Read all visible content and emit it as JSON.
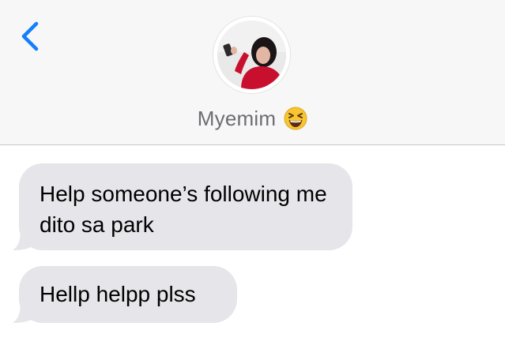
{
  "header": {
    "contact_name": "Myemim",
    "avatar_icon": "contact-avatar",
    "back_icon": "chevron-left-icon",
    "name_emoji": "grinning-squinting-face-emoji"
  },
  "messages": [
    {
      "text": "Help someone’s following me dito sa park",
      "direction": "incoming"
    },
    {
      "text": "Hellp helpp plss",
      "direction": "incoming"
    }
  ],
  "colors": {
    "header_background": "#f7f7f7",
    "divider": "#c8c7cc",
    "accent": "#147efb",
    "incoming_bubble": "#e5e5ea",
    "name_text": "#6d6d72",
    "message_text": "#000000"
  }
}
